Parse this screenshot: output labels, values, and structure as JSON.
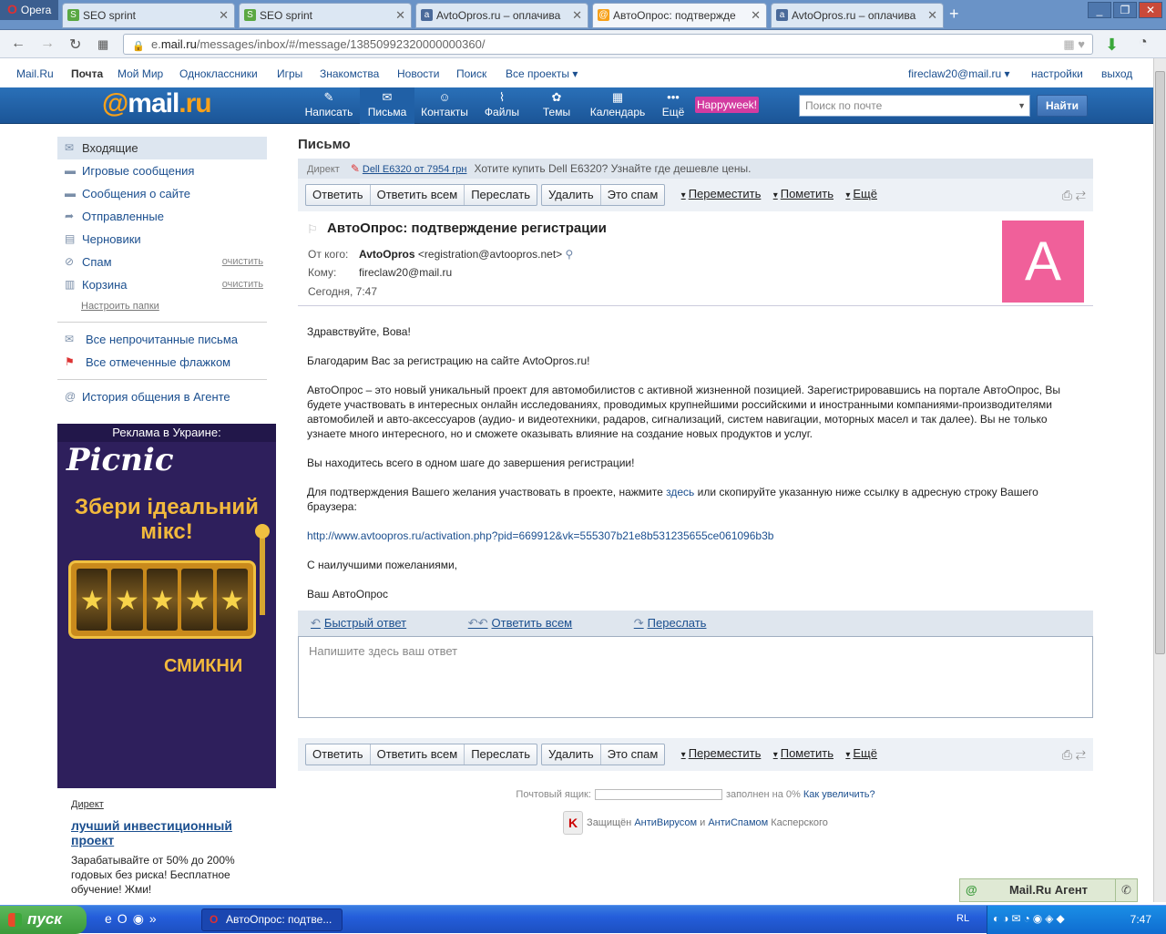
{
  "browser": {
    "menu_label": "Opera",
    "tabs": [
      {
        "title": "SEO sprint",
        "active": false
      },
      {
        "title": "SEO sprint",
        "active": false
      },
      {
        "title": "AvtoOpros.ru – оплачива",
        "active": false
      },
      {
        "title": "АвтоОпрос: подтвержде",
        "active": true
      },
      {
        "title": "AvtoOpros.ru – оплачива",
        "active": false
      }
    ],
    "url_prefix": "e.",
    "url_domain": "mail.ru",
    "url_path": "/messages/inbox/#/message/13850992320000000360/"
  },
  "toplinks": {
    "items": [
      "Mail.Ru",
      "Почта",
      "Мой Мир",
      "Одноклассники",
      "Игры",
      "Знакомства",
      "Новости",
      "Поиск",
      "Все проекты ▾"
    ],
    "user": "fireclaw20@mail.ru ▾",
    "settings": "настройки",
    "logout": "выход"
  },
  "header": {
    "logo_at": "@",
    "logo_mail": "mail",
    "logo_ru": ".ru",
    "nav": [
      {
        "label": "Написать",
        "icon": "✎"
      },
      {
        "label": "Письма",
        "icon": "✉"
      },
      {
        "label": "Контакты",
        "icon": "☺"
      },
      {
        "label": "Файлы",
        "icon": "⌇"
      },
      {
        "label": "Темы",
        "icon": "✿"
      },
      {
        "label": "Календарь",
        "icon": "▦"
      },
      {
        "label": "Ещё",
        "icon": "•••"
      }
    ],
    "happyweek": "Happyweek!",
    "search_placeholder": "Поиск по почте",
    "search_button": "Найти"
  },
  "sidebar": {
    "folders": [
      {
        "label": "Входящие",
        "icon": "✉",
        "clean": ""
      },
      {
        "label": "Игровые сообщения",
        "icon": "▬",
        "clean": ""
      },
      {
        "label": "Сообщения о сайте",
        "icon": "▬",
        "clean": ""
      },
      {
        "label": "Отправленные",
        "icon": "➦",
        "clean": ""
      },
      {
        "label": "Черновики",
        "icon": "▤",
        "clean": ""
      },
      {
        "label": "Спам",
        "icon": "⊘",
        "clean": "очистить"
      },
      {
        "label": "Корзина",
        "icon": "▥",
        "clean": "очистить"
      }
    ],
    "setup": "Настроить папки",
    "extra": [
      {
        "label": "Все непрочитанные письма",
        "icon": "✉"
      },
      {
        "label": "Все отмеченные флажком",
        "icon": "⚑"
      }
    ],
    "agent_history": "История общения в Агенте",
    "ad_title": "Реклама в Украине:",
    "ad_brand": "Picnic",
    "ad_slogan": "Збери ідеальний мікс!",
    "ad_star": "★",
    "ad_cta": "СМИКНИ",
    "direct_label": "Директ",
    "direct_title": "лучший инвестиционный проект",
    "direct_text": "Зарабатывайте от 50% до 200% годовых без риска! Бесплатное обучение! Жми!"
  },
  "main": {
    "page_title": "Письмо",
    "direct_label": "Директ",
    "direct_link": "Dell E6320 от 7954 грн",
    "direct_text": "Хотите купить Dell E6320? Узнайте где дешевле цены.",
    "toolbar": {
      "reply": "Ответить",
      "reply_all": "Ответить всем",
      "forward": "Переслать",
      "delete": "Удалить",
      "spam": "Это спам",
      "move": "Переместить",
      "mark": "Пометить",
      "more": "Ещё"
    },
    "message": {
      "subject": "АвтоОпрос: подтверждение регистрации",
      "from_label": "От кого:",
      "from_name": "AvtoOpros",
      "from_email": "<registration@avtoopros.net>",
      "to_label": "Кому:",
      "to": "fireclaw20@mail.ru",
      "date": "Сегодня, 7:47",
      "avatar_letter": "A",
      "greeting": "Здравствуйте, Вова!",
      "thanks": "Благодарим Вас за регистрацию на сайте AvtoOpros.ru!",
      "about": "АвтоОпрос – это новый уникальный проект для автомобилистов с активной жизненной позицией. Зарегистрировавшись на портале АвтоОпрос, Вы будете участвовать в интересных онлайн исследованиях, проводимых крупнейшими российскими и иностранными компаниями-производителями автомобилей и авто-аксессуаров (аудио- и видеотехники, радаров, сигнализаций, систем навигации, моторных масел и так далее). Вы не только узнаете много интересного, но и сможете оказывать влияние на создание новых продуктов и услуг.",
      "one_step": "Вы находитесь всего в одном шаге до завершения регистрации!",
      "confirm_before": "Для подтверждения Вашего желания участвовать в проекте, нажмите ",
      "confirm_link": "здесь",
      "confirm_after": " или скопируйте указанную ниже ссылку в адресную строку Вашего браузера:",
      "activation_url": "http://www.avtoopros.ru/activation.php?pid=669912&vk=555307b21e8b531235655ce061096b3b",
      "regards": "С наилучшими пожеланиями,",
      "signature": "Ваш АвтоОпрос"
    },
    "quick": {
      "quick_reply": "Быстрый ответ",
      "reply_all": "Ответить всем",
      "forward": "Переслать"
    },
    "reply_placeholder": "Напишите здесь ваш ответ",
    "quota_label": "Почтовый ящик:",
    "quota_fill": "заполнен на 0%",
    "quota_link": "Как увеличить?",
    "kasp_prefix": "Защищён",
    "kasp_av": "АнтиВирусом",
    "kasp_and": "и",
    "kasp_as": "АнтиСпамом",
    "kasp_suffix": "Касперского"
  },
  "agent": {
    "label": "Mail.Ru Агент"
  },
  "taskbar": {
    "start": "пуск",
    "task": "АвтоОпрос: подтве...",
    "lang": "RL",
    "clock": "7:47"
  }
}
